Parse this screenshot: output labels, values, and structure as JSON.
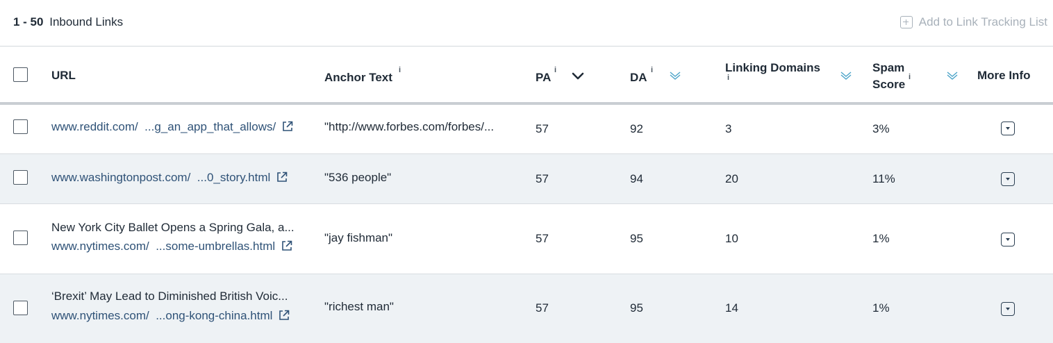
{
  "header": {
    "range": "1 - 50",
    "label": "Inbound Links",
    "add_button_label": "Add to Link Tracking List"
  },
  "columns": {
    "url": "URL",
    "anchor": "Anchor Text",
    "pa": "PA",
    "da": "DA",
    "linking_domains": "Linking Domains",
    "spam_line1": "Spam",
    "spam_line2": "Score",
    "more_info": "More Info",
    "info_glyph": "i"
  },
  "rows": [
    {
      "title": "",
      "url_domain": "www.reddit.com/",
      "url_path": "...g_an_app_that_allows/",
      "anchor": "\"http://www.forbes.com/forbes/...",
      "pa": "57",
      "da": "92",
      "linking_domains": "3",
      "spam": "3%"
    },
    {
      "title": "",
      "url_domain": "www.washingtonpost.com/",
      "url_path": "...0_story.html",
      "anchor": "\"536 people\"",
      "pa": "57",
      "da": "94",
      "linking_domains": "20",
      "spam": "11%"
    },
    {
      "title": "New York City Ballet Opens a Spring Gala, a...",
      "url_domain": "www.nytimes.com/",
      "url_path": "...some-umbrellas.html",
      "anchor": "\"jay fishman\"",
      "pa": "57",
      "da": "95",
      "linking_domains": "10",
      "spam": "1%"
    },
    {
      "title": "‘Brexit’ May Lead to Diminished British Voic...",
      "url_domain": "www.nytimes.com/",
      "url_path": "...ong-kong-china.html",
      "anchor": "\"richest man\"",
      "pa": "57",
      "da": "95",
      "linking_domains": "14",
      "spam": "1%"
    }
  ],
  "icons": {
    "add": "plus-box-icon",
    "external": "external-link-icon",
    "sort_active": "chevron-down-bold-icon",
    "sort_inactive": "double-chevron-down-icon",
    "more": "dropdown-caret-icon"
  },
  "colors": {
    "link": "#2f5277",
    "text": "#1f2a36",
    "muted": "#a8b1ba",
    "row_alt": "#eef2f5",
    "sort_inactive": "#4aa3c8"
  }
}
